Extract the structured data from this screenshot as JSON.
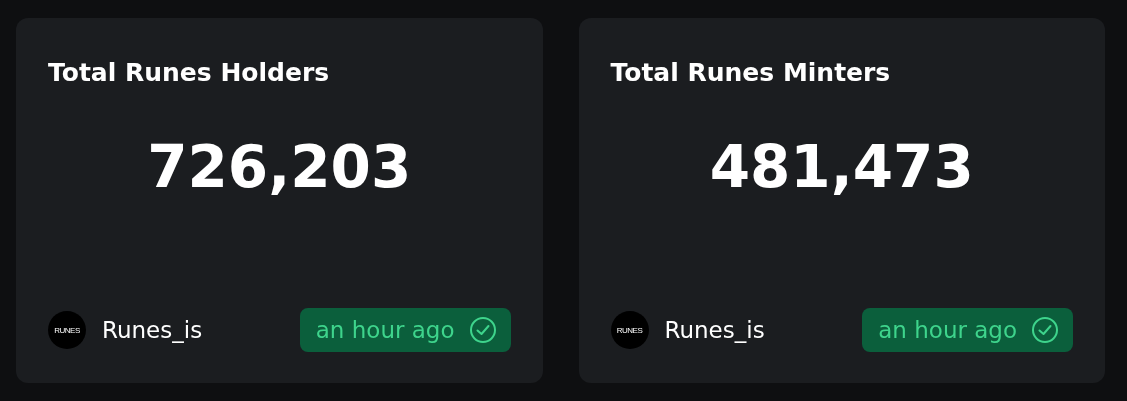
{
  "cards": [
    {
      "title": "Total Runes Holders",
      "value": "726,203",
      "source": {
        "logo_text": "RUNES",
        "name": "Runes_is"
      },
      "status": {
        "label": "an hour ago",
        "verified": true
      }
    },
    {
      "title": "Total Runes Minters",
      "value": "481,473",
      "source": {
        "logo_text": "RUNES",
        "name": "Runes_is"
      },
      "status": {
        "label": "an hour ago",
        "verified": true
      }
    }
  ]
}
